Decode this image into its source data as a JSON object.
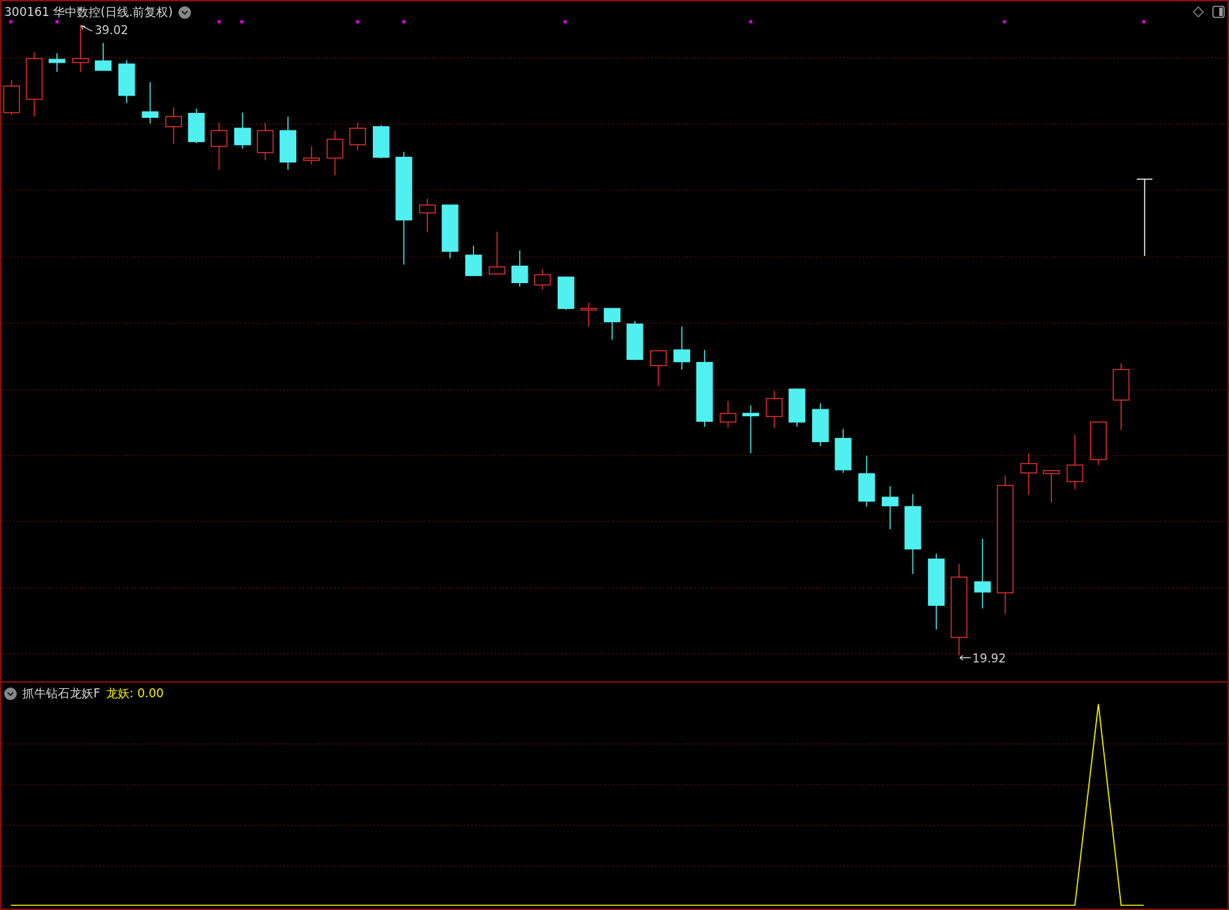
{
  "header": {
    "title": "300161 华中数控(日线.前复权)"
  },
  "main_chart": {
    "high_label": "39.02",
    "low_label": "19.92"
  },
  "indicator": {
    "name": "抓牛钻石龙妖F",
    "value_label": "龙妖: 0.00"
  }
}
